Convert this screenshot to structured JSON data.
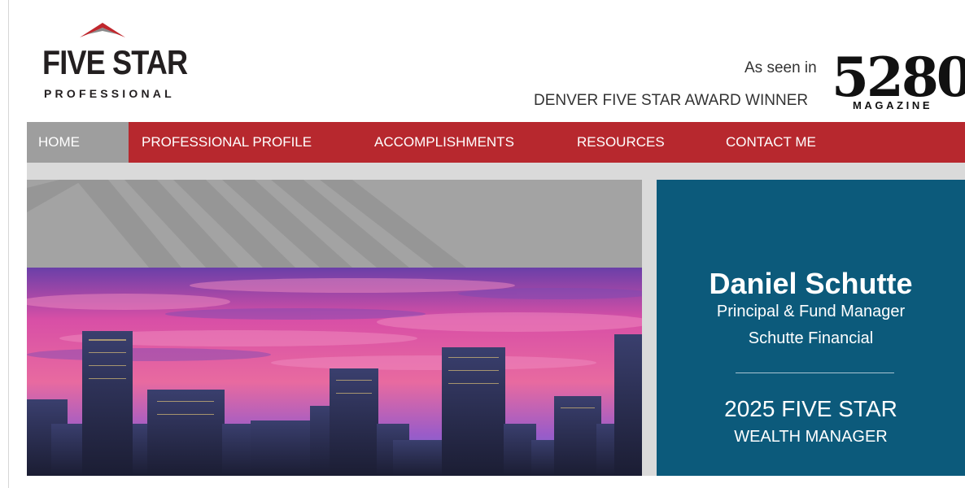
{
  "brand": {
    "logo_title": "FIVE STAR",
    "logo_subtitle": "PROFESSIONAL"
  },
  "header": {
    "as_seen_in": "As seen in",
    "award_text": "DENVER FIVE STAR AWARD WINNER",
    "magazine_number": "5280",
    "magazine_word": "MAGAZINE"
  },
  "nav": {
    "items": [
      {
        "label": "HOME",
        "active": true
      },
      {
        "label": "PROFESSIONAL PROFILE",
        "active": false
      },
      {
        "label": "ACCOMPLISHMENTS",
        "active": false
      },
      {
        "label": "RESOURCES",
        "active": false
      },
      {
        "label": "CONTACT ME",
        "active": false
      }
    ]
  },
  "profile": {
    "name": "Daniel Schutte",
    "title": "Principal & Fund Manager",
    "company": "Schutte Financial",
    "award_year_line": "2025 FIVE STAR",
    "award_role": "WEALTH MANAGER"
  },
  "colors": {
    "nav_red": "#b7282e",
    "nav_active_gray": "#9e9e9e",
    "card_blue": "#0c5a7b",
    "logo_roof": "#c0272d"
  }
}
